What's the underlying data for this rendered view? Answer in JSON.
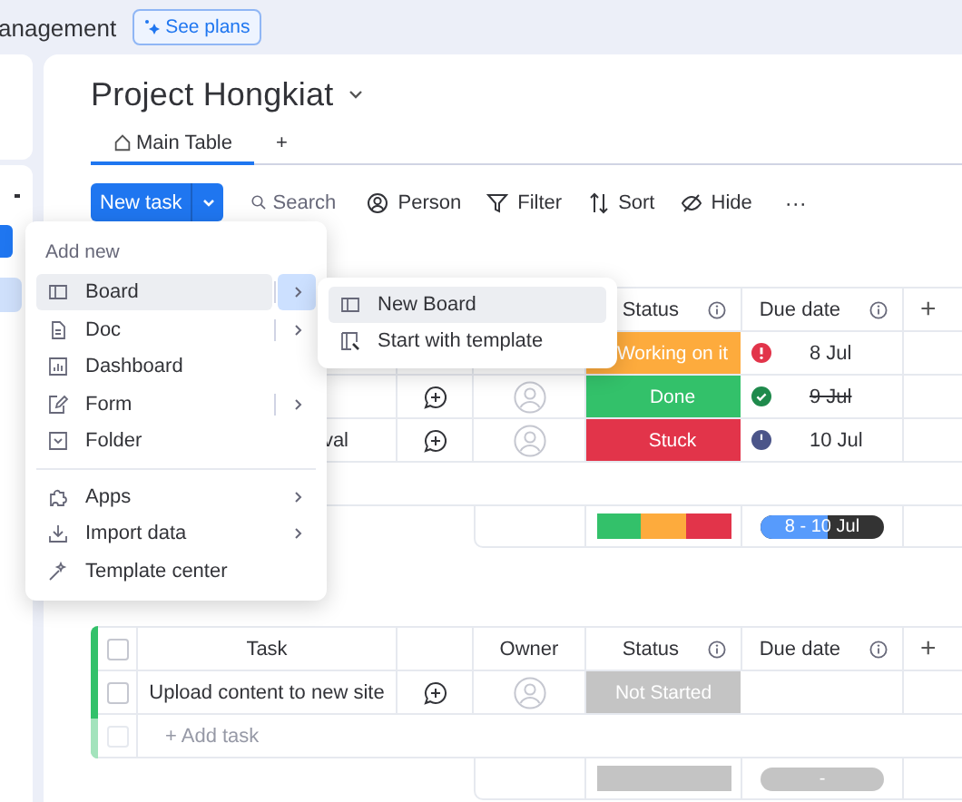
{
  "top_bar": {
    "workspace_name": "anagement",
    "plans_button": "See plans"
  },
  "board": {
    "title": "Project Hongkiat",
    "views": [
      {
        "label": "Main Table",
        "selected": true
      },
      {
        "label": "+",
        "selected": false
      }
    ]
  },
  "toolbar": {
    "new_task": "New task",
    "search": {
      "placeholder": "Search"
    },
    "tools": [
      "Person",
      "Filter",
      "Sort",
      "Hide"
    ],
    "more": "···"
  },
  "tables": [
    {
      "header": {
        "status": "Status",
        "due": "Due date",
        "add_column": "+"
      },
      "rows": [
        {
          "status": "Working on it",
          "color": "#fdab3d",
          "due": "8 Jul",
          "due_icon": {
            "kind": "alert"
          },
          "struck": false
        },
        {
          "comment": true,
          "owner": {
            "kind": "avatar"
          },
          "status": "Done",
          "color": "#33c16a",
          "due": "9 Jul",
          "due_icon": {
            "kind": "check"
          },
          "struck": true
        },
        {
          "task": "val",
          "comment": true,
          "owner": {
            "kind": "avatar"
          },
          "status": "Stuck",
          "color": "#e2344a",
          "due": "10 Jul",
          "due_icon": {
            "kind": "clock"
          },
          "struck": false
        }
      ],
      "summary": {
        "status_segments": [
          {
            "color": "#33c16a"
          },
          {
            "color": "#fdab3d"
          },
          {
            "color": "#e2344a"
          }
        ],
        "date_range": {
          "text": "8 - 10 Jul",
          "level": 0.55
        }
      }
    },
    {
      "color": "#33c16a",
      "header": {
        "checked": false,
        "task": "Task",
        "owner": "Owner",
        "status": "Status",
        "due": "Due date",
        "add_column": "+"
      },
      "rows": [
        {
          "checked": false,
          "task": "Upload content to new site",
          "comment": true,
          "owner": {
            "kind": "avatar"
          },
          "status": "Not Started",
          "color": "#c4c4c4"
        }
      ],
      "add_task": "+ Add task",
      "add_checked": false,
      "summary": {
        "status_segments": [
          {
            "color": "#c4c4c4"
          }
        ],
        "date_range": {
          "text": "-"
        }
      }
    }
  ],
  "add_menu": {
    "heading": "Add new",
    "sections": [
      {
        "items": [
          {
            "label": "Board",
            "selected": true,
            "submenu": true,
            "split": true
          },
          {
            "label": "Doc",
            "selected": false,
            "submenu": true,
            "split": true
          },
          {
            "label": "Dashboard",
            "selected": false,
            "submenu": false,
            "split": false
          },
          {
            "label": "Form",
            "selected": false,
            "submenu": true,
            "split": true
          },
          {
            "label": "Folder",
            "selected": false,
            "submenu": false,
            "split": false
          }
        ]
      },
      {
        "items": [
          {
            "label": "Apps",
            "selected": false,
            "submenu": true,
            "split": false
          },
          {
            "label": "Import data",
            "selected": false,
            "submenu": true,
            "split": false
          },
          {
            "label": "Template center",
            "selected": false,
            "submenu": false,
            "split": false
          }
        ]
      }
    ]
  },
  "board_submenu": {
    "items": [
      {
        "label": "New Board",
        "selected": true
      },
      {
        "label": "Start with template",
        "selected": false
      }
    ]
  }
}
